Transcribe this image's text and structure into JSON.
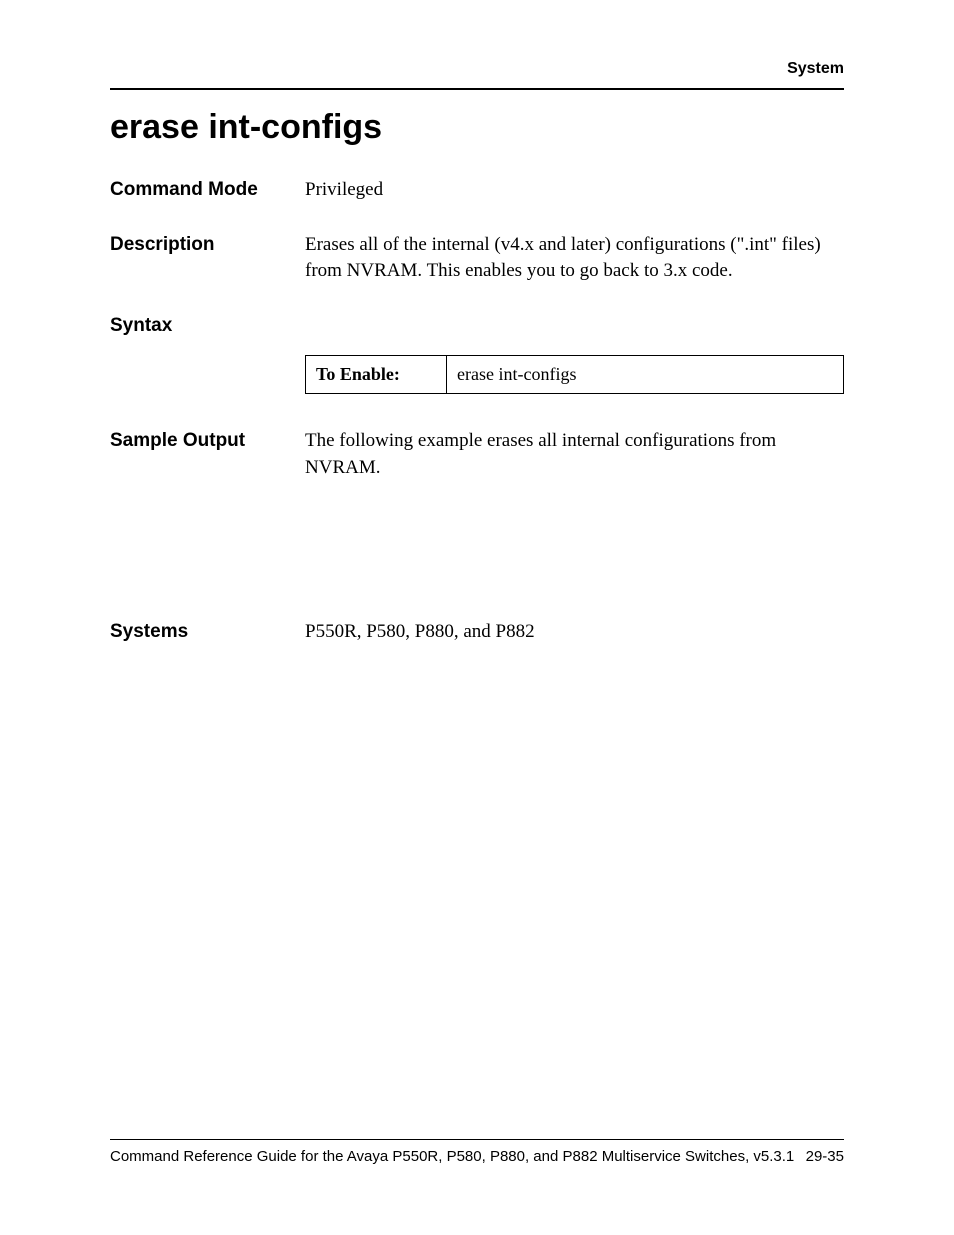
{
  "header": {
    "section": "System"
  },
  "title": "erase int-configs",
  "sections": {
    "command_mode": {
      "label": "Command Mode",
      "value": "Privileged"
    },
    "description": {
      "label": "Description",
      "value": "Erases all of the internal (v4.x and later) configurations (\".int\" files) from NVRAM. This enables you to go back to 3.x code."
    },
    "syntax": {
      "label": "Syntax",
      "table": {
        "left": "To Enable:",
        "right": "erase int-configs"
      }
    },
    "sample_output": {
      "label": "Sample Output",
      "value": "The following example erases all internal configurations from NVRAM."
    },
    "systems": {
      "label": "Systems",
      "value": "P550R, P580, P880, and P882"
    }
  },
  "footer": {
    "left": "Command Reference Guide for the Avaya P550R, P580, P880, and P882 Multiservice Switches, v5.3.1",
    "right": "29-35"
  }
}
